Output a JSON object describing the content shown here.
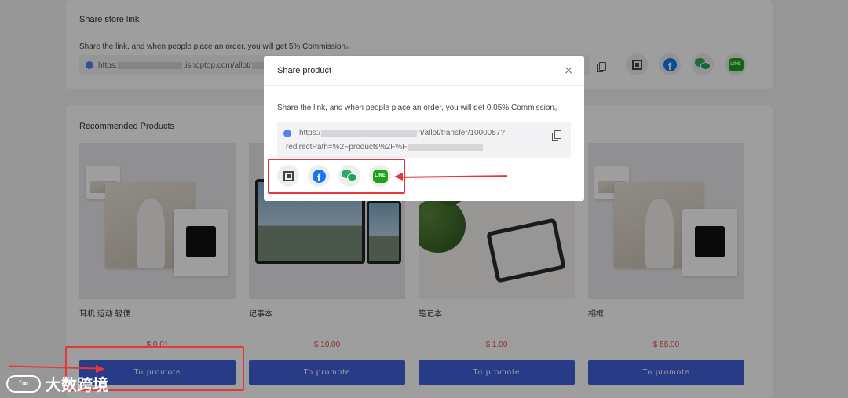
{
  "share_store": {
    "title": "Share store link",
    "description": "Share the link, and when people place an order, you will get 5% Commission。",
    "link_prefix": "https:",
    "link_mid": ".ishoptop.com/allot/"
  },
  "recommended": {
    "title": "Recommended Products",
    "promote_label": "To promote",
    "products": [
      {
        "name": "耳机 运动 轻便",
        "price": "$ 0.01"
      },
      {
        "name": "记事本",
        "price": "$ 10.00"
      },
      {
        "name": "笔记本",
        "price": "$ 1.00"
      },
      {
        "name": "相框",
        "price": "$ 55.00"
      }
    ]
  },
  "modal": {
    "title": "Share product",
    "close_glyph": "×",
    "description": "Share the link, and when people place an order, you will get 0.05% Commission。",
    "link_line1_prefix": "https:/",
    "link_line1_suffix": "n/allot/transfer/1000057?",
    "link_line2": "redirectPath=%2Fproducts%2F%F"
  },
  "share_icons": {
    "line_label": "LINE"
  },
  "watermark": {
    "logo": "‘∞",
    "text": "大数跨境"
  },
  "colors": {
    "accent": "#4060d8",
    "price": "#e35050",
    "highlight": "#e8363a",
    "facebook": "#1877f2",
    "wechat": "#2aae67",
    "line": "#1aa31a"
  }
}
